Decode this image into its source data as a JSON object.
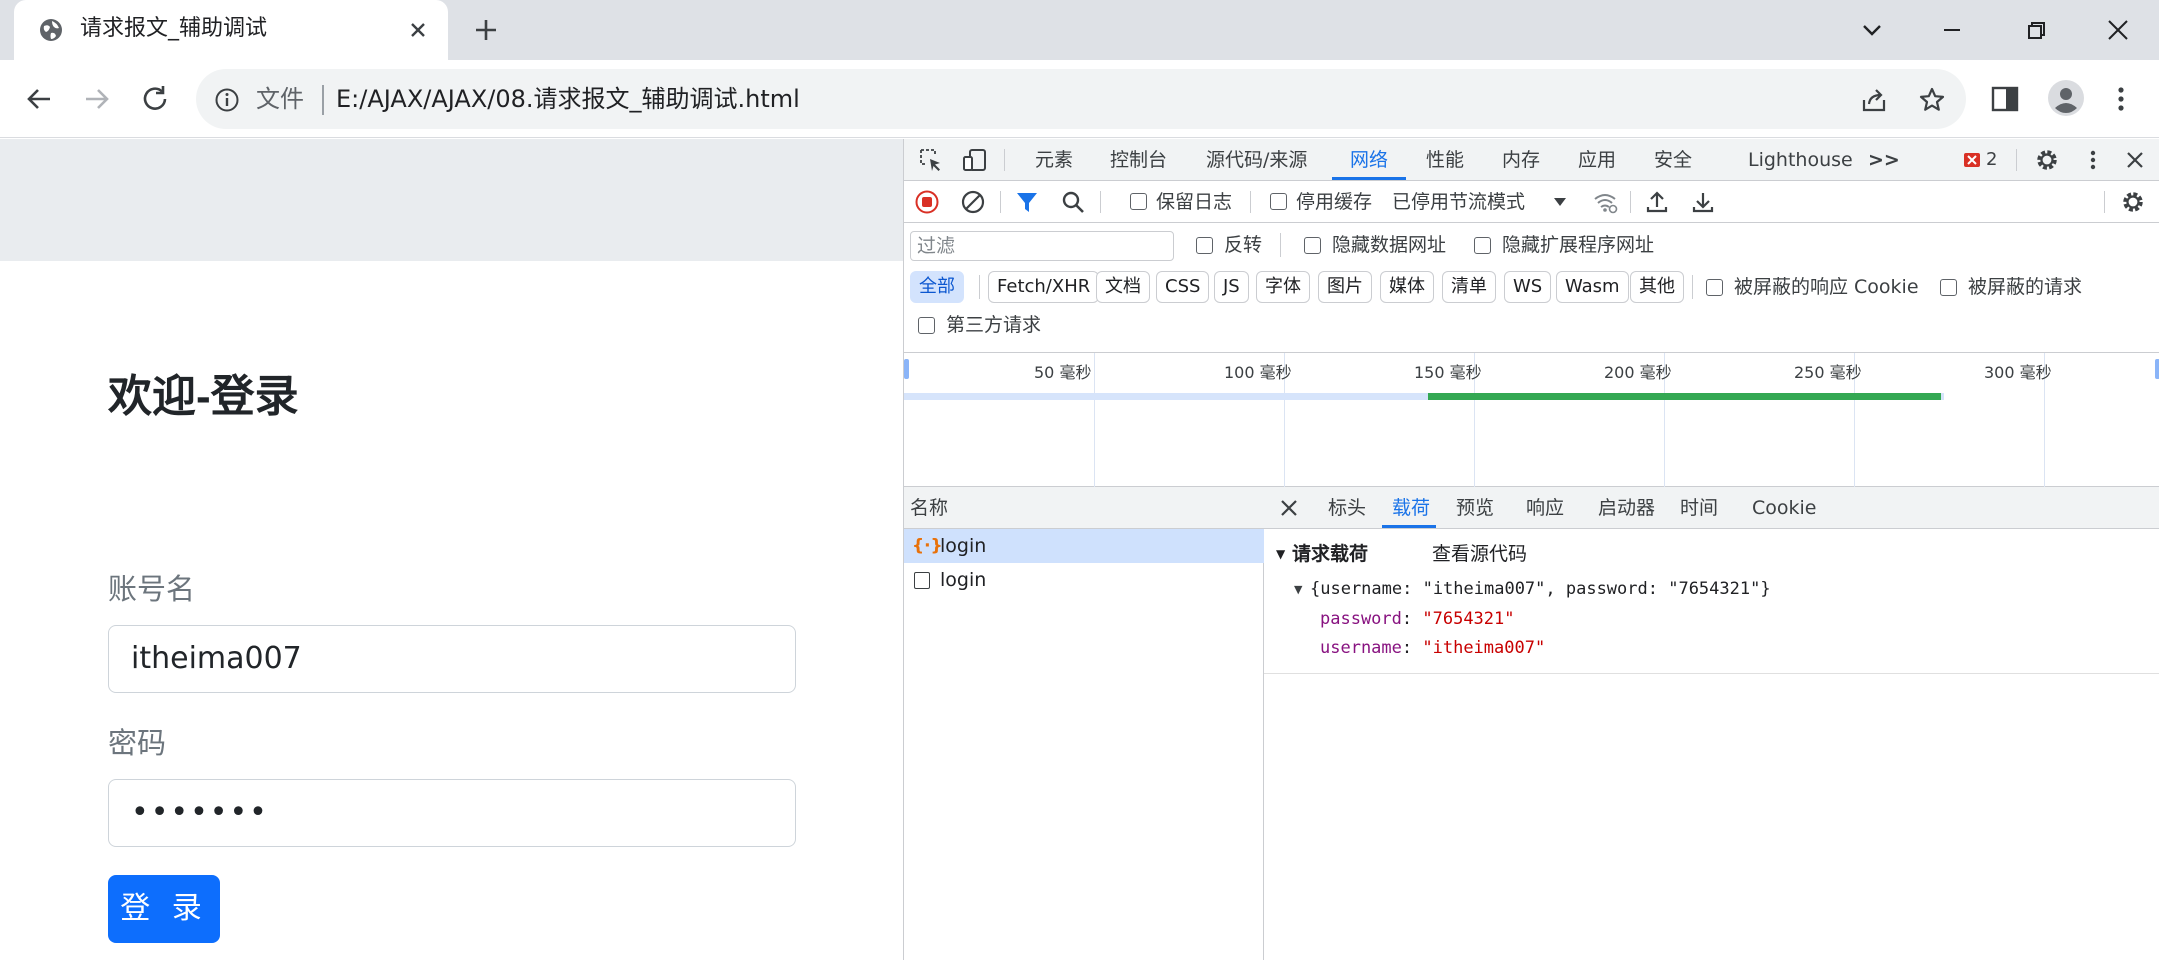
{
  "browser": {
    "tab": {
      "title": "请求报文_辅助调试",
      "favicon": "globe-icon",
      "close_icon": "close-icon"
    },
    "new_tab_icon": "plus-icon",
    "window_controls": [
      "chevron-down-icon",
      "minimize-icon",
      "restore-icon",
      "close-icon"
    ],
    "address": {
      "scheme_label": "文件",
      "url": "E:/AJAX/AJAX/08.请求报文_辅助调试.html"
    }
  },
  "page": {
    "heading": "欢迎-登录",
    "username_label": "账号名",
    "username_value": "itheima007",
    "password_label": "密码",
    "password_mask": "•••••••",
    "login_button": "登 录"
  },
  "devtools": {
    "tabs": [
      "元素",
      "控制台",
      "源代码/来源",
      "网络",
      "性能",
      "内存",
      "应用",
      "安全",
      "Lighthouse"
    ],
    "active_tab": "网络",
    "more_tabs": ">>",
    "error_count": "2",
    "controls": {
      "preserve_log": "保留日志",
      "disable_cache": "停用缓存",
      "throttling": "已停用节流模式"
    },
    "filter": {
      "placeholder": "过滤",
      "invert": "反转",
      "hide_data_urls": "隐藏数据网址",
      "hide_ext_urls": "隐藏扩展程序网址",
      "types": [
        "全部",
        "Fetch/XHR",
        "文档",
        "CSS",
        "JS",
        "字体",
        "图片",
        "媒体",
        "清单",
        "WS",
        "Wasm",
        "其他"
      ],
      "active_type": "全部",
      "blocked_cookies": "被屏蔽的响应 Cookie",
      "blocked_requests": "被屏蔽的请求",
      "third_party": "第三方请求"
    },
    "timeline": {
      "ticks": [
        "50 毫秒",
        "100 毫秒",
        "150 毫秒",
        "200 毫秒",
        "250 毫秒",
        "300 毫秒"
      ],
      "bar_start_ms": 138,
      "bar_end_ms": 273,
      "bar_color": "#34a853"
    },
    "requests": {
      "header": "名称",
      "rows": [
        {
          "name": "login",
          "icon": "xhr-braces-icon",
          "selected": true
        },
        {
          "name": "login",
          "icon": "document-icon",
          "selected": false
        }
      ]
    },
    "detail": {
      "tabs": [
        "标头",
        "载荷",
        "预览",
        "响应",
        "启动器",
        "时间",
        "Cookie"
      ],
      "active_tab": "载荷",
      "section_title": "请求载荷",
      "view_source": "查看源代码",
      "summary": "{username: \"itheima007\", password: \"7654321\"}",
      "fields": [
        {
          "key": "password",
          "value": "\"7654321\""
        },
        {
          "key": "username",
          "value": "\"itheima007\""
        }
      ]
    }
  }
}
